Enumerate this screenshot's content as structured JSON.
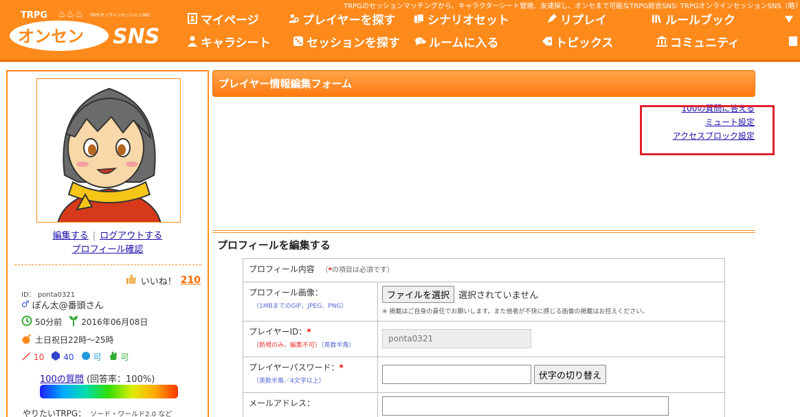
{
  "header": {
    "tagline": "TRPGのセッションマッチングから、キャラクターシート管理、友達探し、オンセまで可能なTRPG総合SNS: TRPGオンラインセッションSNS（略して",
    "logo_top": "TRPG",
    "logo_sub": "TRPGオンラインセッションSNS",
    "logo_main": "オンセン",
    "logo_sns": "SNS",
    "nav_row1": [
      {
        "label": "マイページ",
        "icon": "profile-card-icon"
      },
      {
        "label": "プレイヤーを探す",
        "icon": "people-search-icon"
      },
      {
        "label": "シナリオセット",
        "icon": "cards-icon"
      },
      {
        "label": "リプレイ",
        "icon": "pen-icon"
      },
      {
        "label": "ルールブック",
        "icon": "books-icon"
      }
    ],
    "nav_row2": [
      {
        "label": "キャラシート",
        "icon": "person-icon"
      },
      {
        "label": "セッションを探す",
        "icon": "dice-icon"
      },
      {
        "label": "ルームに入る",
        "icon": "chat-icon"
      },
      {
        "label": "トピックス",
        "icon": "tag-icon"
      },
      {
        "label": "コミュニティ",
        "icon": "building-icon"
      }
    ]
  },
  "sidebar": {
    "edit_link": "編集する",
    "logout_link": "ログアウトする",
    "profile_link": "プロフィール確認",
    "likes_label": "いいね！",
    "likes_count": "210",
    "id_label": "ID： ponta0321",
    "name": "ぽん太@番頭さん",
    "last_login": "50分前",
    "joined": "2016年06月08日",
    "schedule": "土日祝日22時～25時",
    "stat_sword": "10",
    "stat_dice": "40",
    "stat_voice": "可",
    "stat_hand": "可",
    "q100_link": "100の質問",
    "q100_rate": "(回答率：100%)",
    "want_label": "やりたいTRPG：",
    "want_value": "ソード・ワールド2.0 など"
  },
  "main": {
    "form_title": "プレイヤー情報編集フォーム",
    "links": [
      "100の質問に答える",
      "ミュート設定",
      "アクセスブロック設定"
    ],
    "section_title": "プロフィールを編集する",
    "table": {
      "header_label": "プロフィール内容",
      "header_note_open": "（",
      "header_note_star": "*",
      "header_note_rest": "の項目は必須です）",
      "image_label": "プロフィール画像：",
      "image_sub": "（1MBまでのGIF、JPEG、PNG）",
      "file_button": "ファイルを選択",
      "file_status": "選択されていません",
      "image_note": "※ 掲載はご自身の責任でお願いします。また他者が不快に感じる画像の掲載はお控えください。",
      "pid_label": "プレイヤーID：",
      "pid_sub1": "（新規のみ、編集不可）",
      "pid_sub2": "（英数半角）",
      "pid_value": "ponta0321",
      "pw_label": "プレイヤーパスワード：",
      "pw_sub": "（英数半角／4文字以上）",
      "pw_button": "伏字の切り替え",
      "mail_label": "メールアドレス："
    }
  }
}
